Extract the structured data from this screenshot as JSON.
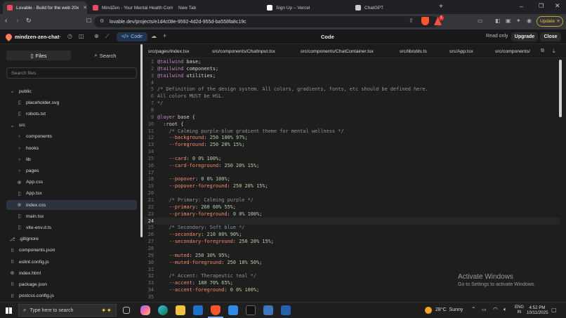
{
  "browser": {
    "tabs": [
      {
        "title": "Lovable - Build for the web 20x",
        "active": true,
        "color": "#e84a5f"
      },
      {
        "title": "MindZen - Your Mental Health Comp",
        "active": false,
        "color": "#e84a5f"
      },
      {
        "title": "New Tab",
        "active": false,
        "color": ""
      },
      {
        "title": "Sign Up – Vercel",
        "active": false,
        "color": "#ffffff"
      },
      {
        "title": "ChatGPT",
        "active": false,
        "color": "#cccccc"
      }
    ],
    "url": "lovable.dev/projects/e1d4c08e-9592-4d2d-955d-ba558fa8c19c",
    "update_label": "Update",
    "badge_count": "1"
  },
  "app": {
    "project_name": "mindzen-zen-chat",
    "code_button": "Code",
    "center_title": "Code",
    "read_only": "Read only",
    "upgrade": "Upgrade",
    "close": "Close"
  },
  "left": {
    "files_tab": "Files",
    "search_tab": "Search",
    "search_placeholder": "Search files",
    "tree": [
      {
        "label": "public",
        "icon": "chevron-down",
        "indent": 0,
        "selected": false
      },
      {
        "label": "placeholder.svg",
        "icon": "file",
        "indent": 1,
        "selected": false
      },
      {
        "label": "robots.txt",
        "icon": "file",
        "indent": 1,
        "selected": false
      },
      {
        "label": "src",
        "icon": "chevron-down",
        "indent": 0,
        "selected": false
      },
      {
        "label": "components",
        "icon": "chevron-right",
        "indent": 1,
        "selected": false
      },
      {
        "label": "hooks",
        "icon": "chevron-right",
        "indent": 1,
        "selected": false
      },
      {
        "label": "lib",
        "icon": "chevron-right",
        "indent": 1,
        "selected": false
      },
      {
        "label": "pages",
        "icon": "chevron-right",
        "indent": 1,
        "selected": false
      },
      {
        "label": "App.css",
        "icon": "globe",
        "indent": 1,
        "selected": false
      },
      {
        "label": "App.tsx",
        "icon": "file",
        "indent": 1,
        "selected": false
      },
      {
        "label": "index.css",
        "icon": "globe",
        "indent": 1,
        "selected": true
      },
      {
        "label": "main.tsx",
        "icon": "file",
        "indent": 1,
        "selected": false
      },
      {
        "label": "vite-env.d.ts",
        "icon": "file",
        "indent": 1,
        "selected": false
      },
      {
        "label": ".gitignore",
        "icon": "git",
        "indent": 0,
        "selected": false
      },
      {
        "label": "components.json",
        "icon": "braces",
        "indent": 0,
        "selected": false
      },
      {
        "label": "eslint.config.js",
        "icon": "braces",
        "indent": 0,
        "selected": false
      },
      {
        "label": "index.html",
        "icon": "globe",
        "indent": 0,
        "selected": false
      },
      {
        "label": "package.json",
        "icon": "braces",
        "indent": 0,
        "selected": false
      },
      {
        "label": "postcss.config.js",
        "icon": "braces",
        "indent": 0,
        "selected": false
      }
    ]
  },
  "editor": {
    "tabs": [
      "src/pages/Index.tsx",
      "src/components/ChatInput.tsx",
      "src/components/ChatContainer.tsx",
      "src/lib/utils.ts",
      "src/App.tsx",
      "src/components/"
    ],
    "current_line": 24,
    "lines": [
      [
        [
          "@tailwind",
          "at"
        ],
        [
          " base;",
          "kw"
        ]
      ],
      [
        [
          "@tailwind",
          "at"
        ],
        [
          " components;",
          "kw"
        ]
      ],
      [
        [
          "@tailwind",
          "at"
        ],
        [
          " utilities;",
          "kw"
        ]
      ],
      [],
      [
        [
          "/* Definition of the design system. All colors, gradients, fonts, etc should be defined here.",
          "com"
        ]
      ],
      [
        [
          "All colors MUST be HSL.",
          "com"
        ]
      ],
      [
        [
          "*/",
          "com"
        ]
      ],
      [],
      [
        [
          "@layer",
          "at"
        ],
        [
          " base {",
          "kw"
        ]
      ],
      [
        [
          "  :root {",
          "sel"
        ]
      ],
      [
        [
          "    /* Calming purple-blue gradient theme for mental wellness */",
          "com"
        ]
      ],
      [
        [
          "    --background",
          "var"
        ],
        [
          ": ",
          "kw"
        ],
        [
          "250 100% 97%",
          "num"
        ],
        [
          ";",
          "kw"
        ]
      ],
      [
        [
          "    --foreground",
          "var"
        ],
        [
          ": ",
          "kw"
        ],
        [
          "250 20% 15%",
          "num"
        ],
        [
          ";",
          "kw"
        ]
      ],
      [],
      [
        [
          "    --card",
          "var"
        ],
        [
          ": ",
          "kw"
        ],
        [
          "0 0% 100%",
          "num"
        ],
        [
          ";",
          "kw"
        ]
      ],
      [
        [
          "    --card-foreground",
          "var"
        ],
        [
          ": ",
          "kw"
        ],
        [
          "250 20% 15%",
          "num"
        ],
        [
          ";",
          "kw"
        ]
      ],
      [],
      [
        [
          "    --popover",
          "var"
        ],
        [
          ": ",
          "kw"
        ],
        [
          "0 0% 100%",
          "num"
        ],
        [
          ";",
          "kw"
        ]
      ],
      [
        [
          "    --popover-foreground",
          "var"
        ],
        [
          ": ",
          "kw"
        ],
        [
          "250 20% 15%",
          "num"
        ],
        [
          ";",
          "kw"
        ]
      ],
      [],
      [
        [
          "    /* Primary: Calming purple */",
          "com"
        ]
      ],
      [
        [
          "    --primary",
          "var"
        ],
        [
          ": ",
          "kw"
        ],
        [
          "260 60% 55%",
          "num"
        ],
        [
          ";",
          "kw"
        ]
      ],
      [
        [
          "    --primary-foreground",
          "var"
        ],
        [
          ": ",
          "kw"
        ],
        [
          "0 0% 100%",
          "num"
        ],
        [
          ";",
          "kw"
        ]
      ],
      [],
      [
        [
          "    /* Secondary: Soft blue */",
          "com"
        ]
      ],
      [
        [
          "    --secondary",
          "var"
        ],
        [
          ": ",
          "kw"
        ],
        [
          "210 80% 90%",
          "num"
        ],
        [
          ";",
          "kw"
        ]
      ],
      [
        [
          "    --secondary-foreground",
          "var"
        ],
        [
          ": ",
          "kw"
        ],
        [
          "250 20% 15%",
          "num"
        ],
        [
          ";",
          "kw"
        ]
      ],
      [],
      [
        [
          "    --muted",
          "var"
        ],
        [
          ": ",
          "kw"
        ],
        [
          "250 30% 95%",
          "num"
        ],
        [
          ";",
          "kw"
        ]
      ],
      [
        [
          "    --muted-foreground",
          "var"
        ],
        [
          ": ",
          "kw"
        ],
        [
          "250 10% 50%",
          "num"
        ],
        [
          ";",
          "kw"
        ]
      ],
      [],
      [
        [
          "    /* Accent: Therapeutic teal */",
          "com"
        ]
      ],
      [
        [
          "    --accent",
          "var"
        ],
        [
          ": ",
          "kw"
        ],
        [
          "180 70% 65%",
          "num"
        ],
        [
          ";",
          "kw"
        ]
      ],
      [
        [
          "    --accent-foreground",
          "var"
        ],
        [
          ": ",
          "kw"
        ],
        [
          "0 0% 100%",
          "num"
        ],
        [
          ";",
          "kw"
        ]
      ],
      []
    ]
  },
  "watermark": {
    "title": "Activate Windows",
    "subtitle": "Go to Settings to activate Windows."
  },
  "taskbar": {
    "search_placeholder": "Type here to search",
    "weather": "28°C  Sunny",
    "lang": "ENG",
    "region": "IN",
    "time": "4:52 PM",
    "date": "10/11/2025"
  }
}
